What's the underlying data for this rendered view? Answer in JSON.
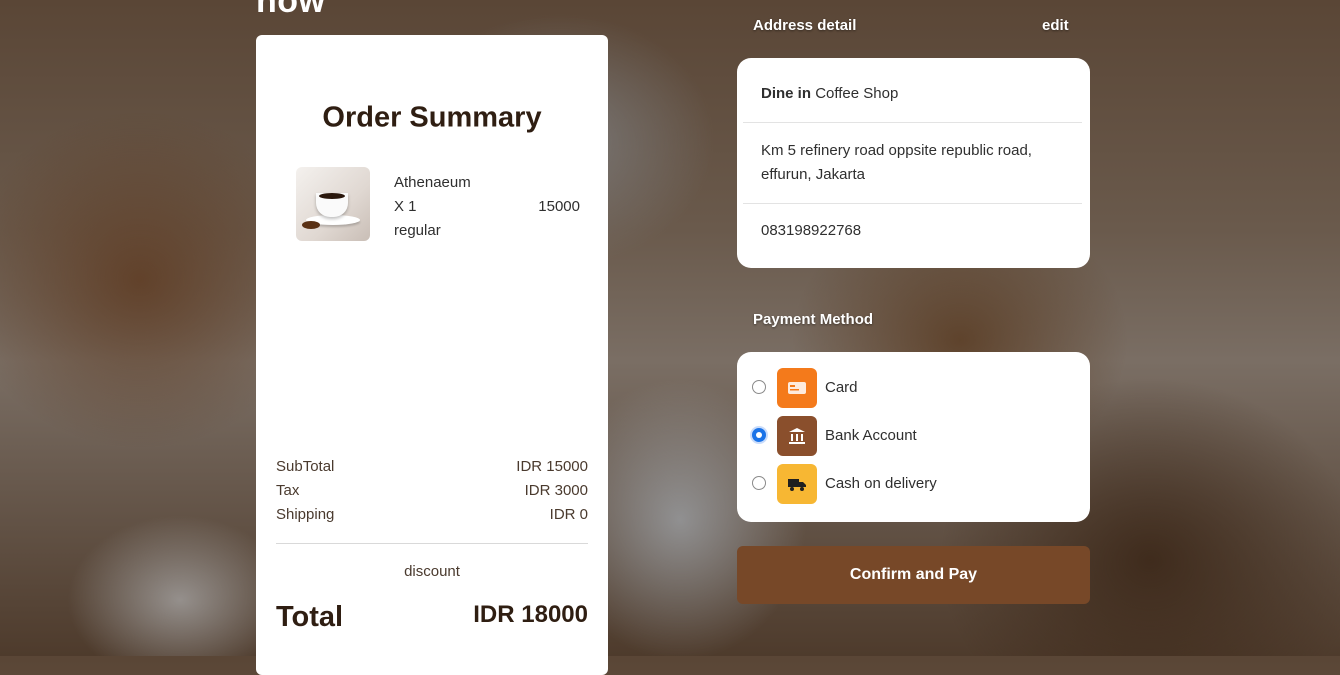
{
  "page": {
    "heading_partial": "now"
  },
  "order_summary": {
    "title": "Order Summary",
    "item": {
      "name": "Athenaeum",
      "quantity": "X 1",
      "size": "regular",
      "price": "15000"
    },
    "subtotal_label": "SubTotal",
    "subtotal_value": "IDR 15000",
    "tax_label": "Tax",
    "tax_value": "IDR 3000",
    "shipping_label": "Shipping",
    "shipping_value": "IDR 0",
    "discount_label": "discount",
    "total_label": "Total",
    "total_value": "IDR 18000"
  },
  "address": {
    "section_title": "Address detail",
    "edit_label": "edit",
    "dine_in_label": "Dine in",
    "location": "Coffee Shop",
    "street": "Km 5 refinery road oppsite republic road, effurun, Jakarta",
    "phone": "083198922768"
  },
  "payment": {
    "section_title": "Payment Method",
    "methods": [
      {
        "label": "Card",
        "icon": "credit-card-icon",
        "color": "#f47a1b",
        "selected": false
      },
      {
        "label": "Bank Account",
        "icon": "bank-icon",
        "color": "#8a4f2c",
        "selected": true
      },
      {
        "label": "Cash on delivery",
        "icon": "delivery-truck-icon",
        "color": "#f7b733",
        "selected": false
      }
    ]
  },
  "confirm_button_label": "Confirm and Pay",
  "colors": {
    "brand": "#774828",
    "dark_text": "#2f1e12",
    "radio_selected": "#1a73e8"
  }
}
